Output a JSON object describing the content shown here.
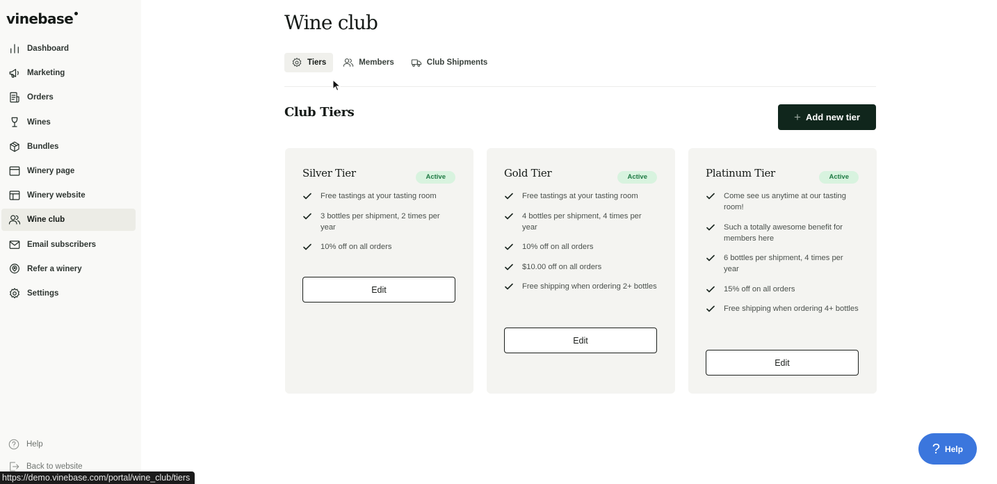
{
  "app": {
    "logo": "vinebase"
  },
  "sidebar": {
    "items": [
      {
        "label": "Dashboard",
        "icon": "bar-chart-icon"
      },
      {
        "label": "Marketing",
        "icon": "megaphone-icon"
      },
      {
        "label": "Orders",
        "icon": "receipt-icon"
      },
      {
        "label": "Wines",
        "icon": "wine-glass-icon"
      },
      {
        "label": "Bundles",
        "icon": "box-icon"
      },
      {
        "label": "Winery page",
        "icon": "browser-window-icon"
      },
      {
        "label": "Winery website",
        "icon": "layout-icon"
      },
      {
        "label": "Wine club",
        "icon": "users-icon",
        "active": true
      },
      {
        "label": "Email subscribers",
        "icon": "mail-icon"
      },
      {
        "label": "Refer a winery",
        "icon": "map-pin-icon"
      },
      {
        "label": "Settings",
        "icon": "gear-icon"
      }
    ],
    "help": "Help",
    "back": "Back to website"
  },
  "status_url": "https://demo.vinebase.com/portal/wine_club/tiers",
  "page": {
    "title": "Wine club",
    "tabs": [
      {
        "label": "Tiers",
        "icon": "gear-icon",
        "active": true
      },
      {
        "label": "Members",
        "icon": "users-icon"
      },
      {
        "label": "Club Shipments",
        "icon": "truck-icon"
      }
    ],
    "section_title": "Club Tiers",
    "add_button": "Add new tier"
  },
  "tiers": [
    {
      "name": "Silver Tier",
      "status": "Active",
      "benefits": [
        "Free tastings at your tasting room",
        "3 bottles per shipment, 2 times per year",
        "10% off on all orders"
      ],
      "edit": "Edit"
    },
    {
      "name": "Gold Tier",
      "status": "Active",
      "benefits": [
        "Free tastings at your tasting room",
        "4 bottles per shipment, 4 times per year",
        "10% off on all orders",
        "$10.00 off on all orders",
        "Free shipping when ordering 2+ bottles"
      ],
      "edit": "Edit"
    },
    {
      "name": "Platinum Tier",
      "status": "Active",
      "benefits": [
        "Come see us anytime at our tasting room!",
        "Such a totally awesome benefit for members here",
        "6 bottles per shipment, 4 times per year",
        "15% off on all orders",
        "Free shipping when ordering 4+ bottles"
      ],
      "edit": "Edit"
    }
  ],
  "help_fab": {
    "label": "Help"
  },
  "colors": {
    "accent_dark": "#10261c",
    "badge_bg": "#d8f3df",
    "badge_text": "#1f7a44",
    "help_blue": "#3b76dd"
  }
}
